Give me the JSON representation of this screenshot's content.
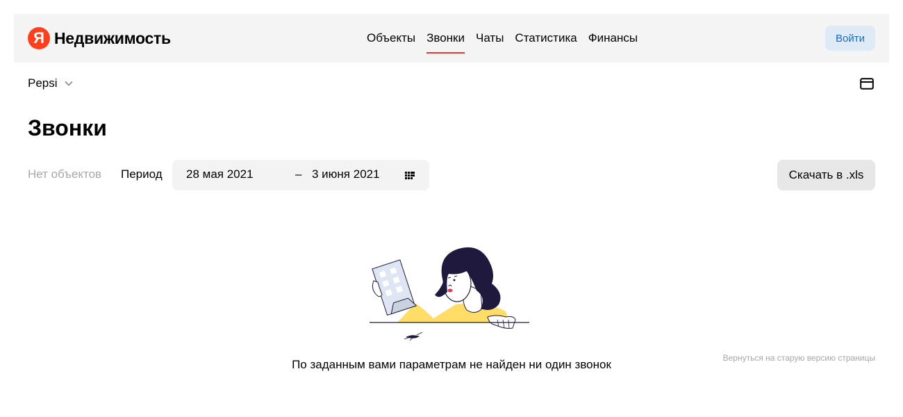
{
  "header": {
    "logo_letter": "Я",
    "logo_text": "Недвижимость",
    "nav": [
      {
        "label": "Объекты",
        "active": false
      },
      {
        "label": "Звонки",
        "active": true
      },
      {
        "label": "Чаты",
        "active": false
      },
      {
        "label": "Статистика",
        "active": false
      },
      {
        "label": "Финансы",
        "active": false
      }
    ],
    "login_label": "Войти"
  },
  "account": {
    "name": "Pepsi",
    "icon": "chevron-down-icon"
  },
  "mail_icon": "mail-icon",
  "page": {
    "title": "Звонки",
    "no_objects": "Нет объектов",
    "period_label": "Период",
    "date_from": "28 мая 2021",
    "dash": "–",
    "date_to": "3 июня 2021",
    "calendar_icon": "calendar-icon",
    "download_label": "Скачать в .xls",
    "empty_message": "По заданным вами параметрам не найден ни один звонок",
    "old_version_link": "Вернуться на старую версию страницы"
  },
  "colors": {
    "brand": "#fc3f1d",
    "active_underline": "#e53935",
    "login_bg": "#deebf7",
    "login_text": "#1a6bc6",
    "muted": "#a8a8a8"
  }
}
